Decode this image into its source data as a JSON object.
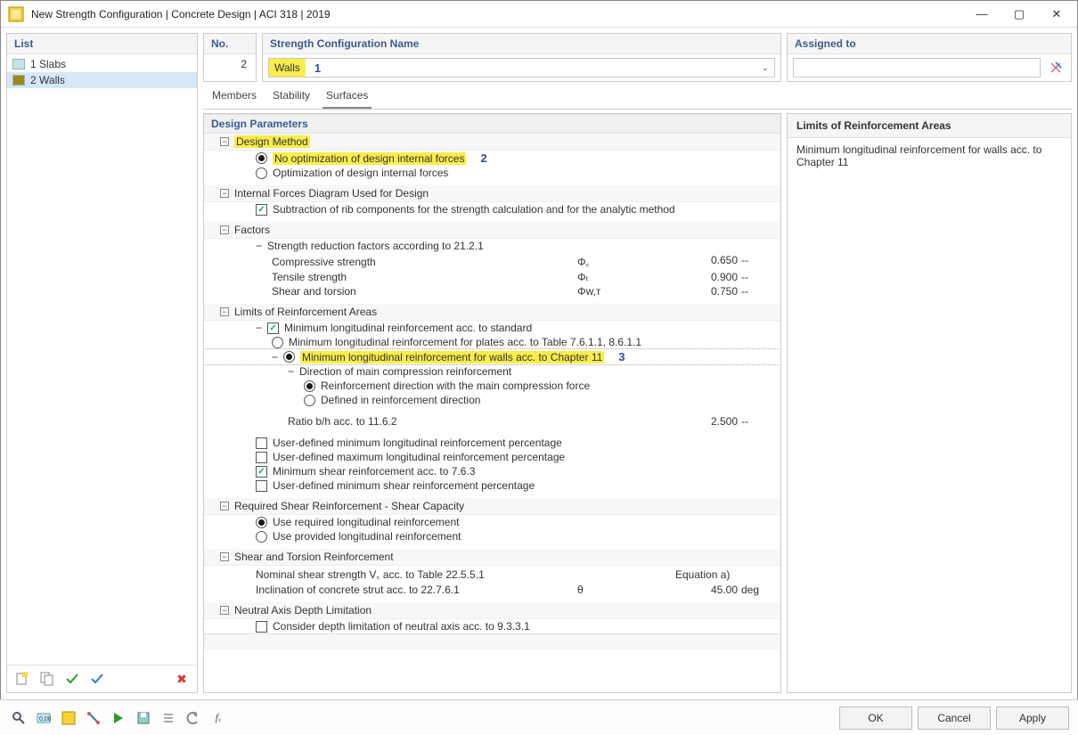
{
  "window": {
    "title": "New Strength Configuration | Concrete Design | ACI 318 | 2019"
  },
  "left": {
    "header": "List",
    "items": [
      {
        "label": "1 Slabs",
        "color": "#bfe6e6",
        "selected": false
      },
      {
        "label": "2 Walls",
        "color": "#9a8a1e",
        "selected": true
      }
    ]
  },
  "no": {
    "header": "No.",
    "value": "2"
  },
  "name": {
    "header": "Strength Configuration Name",
    "value": "Walls",
    "callout": "1"
  },
  "assigned": {
    "header": "Assigned to"
  },
  "tabs": [
    "Members",
    "Stability",
    "Surfaces"
  ],
  "active_tab": 2,
  "params": {
    "title": "Design Parameters",
    "design_method": {
      "label": "Design Method",
      "opt_no": "No optimization of design internal forces",
      "opt_yes": "Optimization of design internal forces",
      "callout": "2"
    },
    "internal_forces": {
      "label": "Internal Forces Diagram Used for Design",
      "sub": "Subtraction of rib components for the strength calculation and for the analytic method"
    },
    "factors": {
      "label": "Factors",
      "sub": "Strength reduction factors according to 21.2.1",
      "rows": [
        {
          "name": "Compressive strength",
          "sym": "Φ꜀",
          "val": "0.650",
          "unit": "--"
        },
        {
          "name": "Tensile strength",
          "sym": "Φₜ",
          "val": "0.900",
          "unit": "--"
        },
        {
          "name": "Shear and torsion",
          "sym": "Φw,ᴛ",
          "val": "0.750",
          "unit": "--"
        }
      ]
    },
    "limits": {
      "label": "Limits of Reinforcement Areas",
      "min_long": "Minimum longitudinal reinforcement acc. to standard",
      "plates": "Minimum longitudinal reinforcement for plates acc. to Table 7.6.1.1, 8.6.1.1",
      "walls": "Minimum longitudinal reinforcement for walls acc. to Chapter 11",
      "callout": "3",
      "dir_head": "Direction of main compression reinforcement",
      "dir_a": "Reinforcement direction with the main compression force",
      "dir_b": "Defined in reinforcement direction",
      "ratio": {
        "name": "Ratio b/h acc. to 11.6.2",
        "val": "2.500",
        "unit": "--"
      },
      "ud_minlong": "User-defined minimum longitudinal reinforcement percentage",
      "ud_maxlong": "User-defined maximum longitudinal reinforcement percentage",
      "min_shear": "Minimum shear reinforcement acc. to 7.6.3",
      "ud_minshear": "User-defined minimum shear reinforcement percentage"
    },
    "req_shear": {
      "label": "Required Shear Reinforcement - Shear Capacity",
      "use_req": "Use required longitudinal reinforcement",
      "use_prov": "Use provided longitudinal reinforcement"
    },
    "shear_torsion": {
      "label": "Shear and Torsion Reinforcement",
      "nominal": {
        "name": "Nominal shear strength V꜀ acc. to Table 22.5.5.1",
        "val": "Equation a)"
      },
      "incl": {
        "name": "Inclination of concrete strut acc. to 22.7.6.1",
        "sym": "θ",
        "val": "45.00",
        "unit": "deg"
      }
    },
    "neutral": {
      "label": "Neutral Axis Depth Limitation",
      "consider": "Consider depth limitation of neutral axis acc. to 9.3.3.1"
    }
  },
  "help": {
    "header": "Limits of Reinforcement Areas",
    "text": "Minimum longitudinal reinforcement for walls acc. to Chapter 11"
  },
  "buttons": {
    "ok": "OK",
    "cancel": "Cancel",
    "apply": "Apply"
  }
}
